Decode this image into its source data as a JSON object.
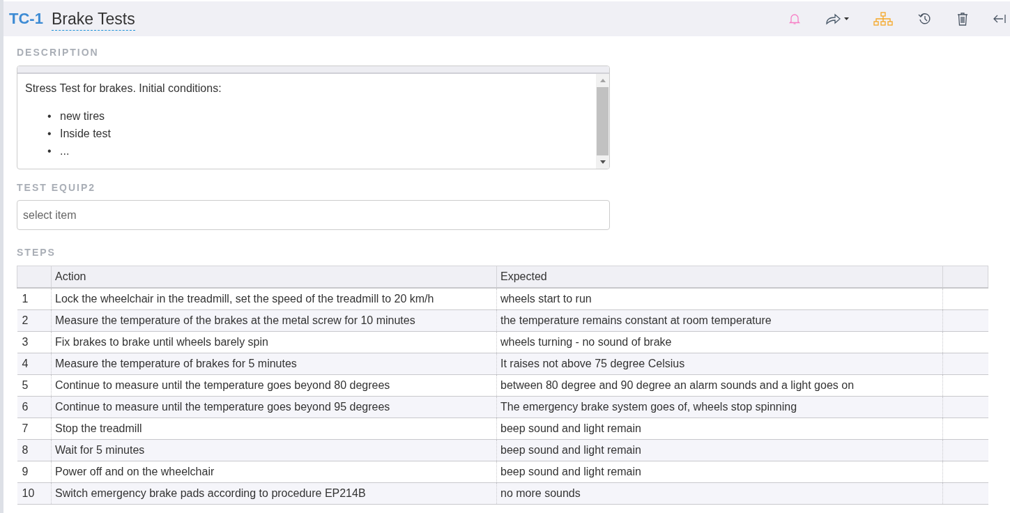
{
  "header": {
    "id": "TC-1",
    "title": "Brake Tests"
  },
  "description": {
    "label": "DESCRIPTION",
    "intro": "Stress Test for brakes. Initial conditions:",
    "bullets": [
      {
        "marker": "•",
        "text": "new tires"
      },
      {
        "marker": "•",
        "text": "Inside test"
      },
      {
        "marker": "•",
        "text": "..."
      }
    ]
  },
  "test_equip": {
    "label": "TEST EQUIP2",
    "placeholder": "select item"
  },
  "steps": {
    "label": "STEPS",
    "columns": [
      "",
      "Action",
      "Expected",
      ""
    ],
    "rows": [
      {
        "number": "1",
        "action": "Lock the wheelchair in the treadmill, set the speed of the treadmill to 20 km/h",
        "expected": "wheels start to run"
      },
      {
        "number": "2",
        "action": "Measure the temperature of the brakes at the metal screw for 10 minutes",
        "expected": "the temperature remains constant at room temperature"
      },
      {
        "number": "3",
        "action": "Fix brakes to brake until wheels barely spin",
        "expected": "wheels turning - no sound of brake"
      },
      {
        "number": "4",
        "action": "Measure the temperature of brakes for 5 minutes",
        "expected": "It raises not above 75 degree Celsius"
      },
      {
        "number": "5",
        "action": "Continue to measure until the temperature goes beyond 80 degrees",
        "expected": "between 80 degree and 90 degree an alarm sounds and a light goes on"
      },
      {
        "number": "6",
        "action": "Continue to measure until the temperature goes beyond 95 degrees",
        "expected": "The emergency brake system goes of, wheels stop spinning"
      },
      {
        "number": "7",
        "action": "Stop the treadmill",
        "expected": "beep sound and light remain"
      },
      {
        "number": "8",
        "action": "Wait for 5 minutes",
        "expected": "beep sound and light remain"
      },
      {
        "number": "9",
        "action": "Power off and on the wheelchair",
        "expected": "beep sound and light remain"
      },
      {
        "number": "10",
        "action": "Switch emergency brake pads according to procedure EP214B",
        "expected": "no more sounds"
      }
    ]
  }
}
